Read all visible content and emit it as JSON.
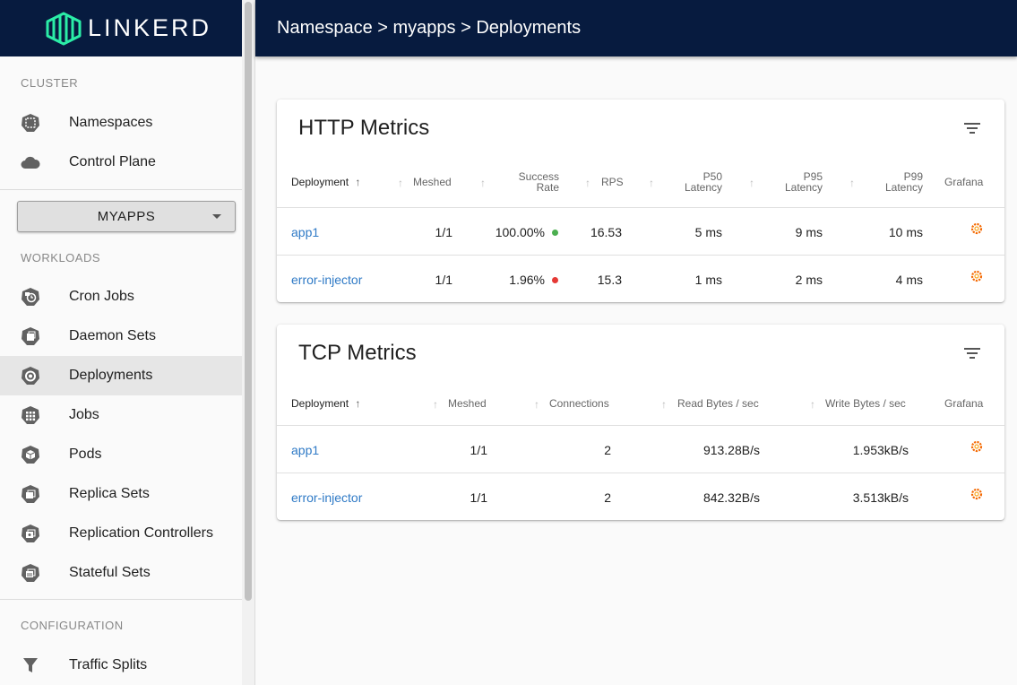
{
  "brand": {
    "name": "LINKERD"
  },
  "header": {
    "breadcrumb": [
      "Namespace",
      "myapps",
      "Deployments"
    ],
    "separator": " > "
  },
  "sidebar": {
    "cluster_label": "CLUSTER",
    "cluster_items": [
      {
        "label": "Namespaces",
        "icon": "namespace-icon"
      },
      {
        "label": "Control Plane",
        "icon": "cloud-icon"
      }
    ],
    "namespace_select": "MYAPPS",
    "workloads_label": "WORKLOADS",
    "workload_items": [
      {
        "label": "Cron Jobs",
        "icon": "cron-jobs-icon"
      },
      {
        "label": "Daemon Sets",
        "icon": "daemon-sets-icon"
      },
      {
        "label": "Deployments",
        "icon": "deployments-icon",
        "active": true
      },
      {
        "label": "Jobs",
        "icon": "jobs-icon"
      },
      {
        "label": "Pods",
        "icon": "pods-icon"
      },
      {
        "label": "Replica Sets",
        "icon": "replica-sets-icon"
      },
      {
        "label": "Replication Controllers",
        "icon": "replication-controllers-icon"
      },
      {
        "label": "Stateful Sets",
        "icon": "stateful-sets-icon"
      }
    ],
    "configuration_label": "CONFIGURATION",
    "configuration_items": [
      {
        "label": "Traffic Splits",
        "icon": "filter-funnel-icon"
      }
    ]
  },
  "http_metrics": {
    "title": "HTTP Metrics",
    "columns": {
      "deployment": "Deployment",
      "meshed": "Meshed",
      "success_rate_1": "Success",
      "success_rate_2": "Rate",
      "rps": "RPS",
      "p50_1": "P50",
      "p50_2": "Latency",
      "p95_1": "P95",
      "p95_2": "Latency",
      "p99_1": "P99",
      "p99_2": "Latency",
      "grafana": "Grafana"
    },
    "rows": [
      {
        "deployment": "app1",
        "meshed": "1/1",
        "success_rate": "100.00%",
        "status_color": "#4caf50",
        "rps": "16.53",
        "p50": "5 ms",
        "p95": "9 ms",
        "p99": "10 ms"
      },
      {
        "deployment": "error-injector",
        "meshed": "1/1",
        "success_rate": "1.96%",
        "status_color": "#e53935",
        "rps": "15.3",
        "p50": "1 ms",
        "p95": "2 ms",
        "p99": "4 ms"
      }
    ]
  },
  "tcp_metrics": {
    "title": "TCP Metrics",
    "columns": {
      "deployment": "Deployment",
      "meshed": "Meshed",
      "connections": "Connections",
      "read": "Read Bytes / sec",
      "write": "Write Bytes / sec",
      "grafana": "Grafana"
    },
    "rows": [
      {
        "deployment": "app1",
        "meshed": "1/1",
        "connections": "2",
        "read": "913.28B/s",
        "write": "1.953kB/s"
      },
      {
        "deployment": "error-injector",
        "meshed": "1/1",
        "connections": "2",
        "read": "842.32B/s",
        "write": "3.513kB/s"
      }
    ]
  },
  "colors": {
    "navy": "#071b3f",
    "link": "#2f7ac6",
    "grafana": "#f46800"
  }
}
